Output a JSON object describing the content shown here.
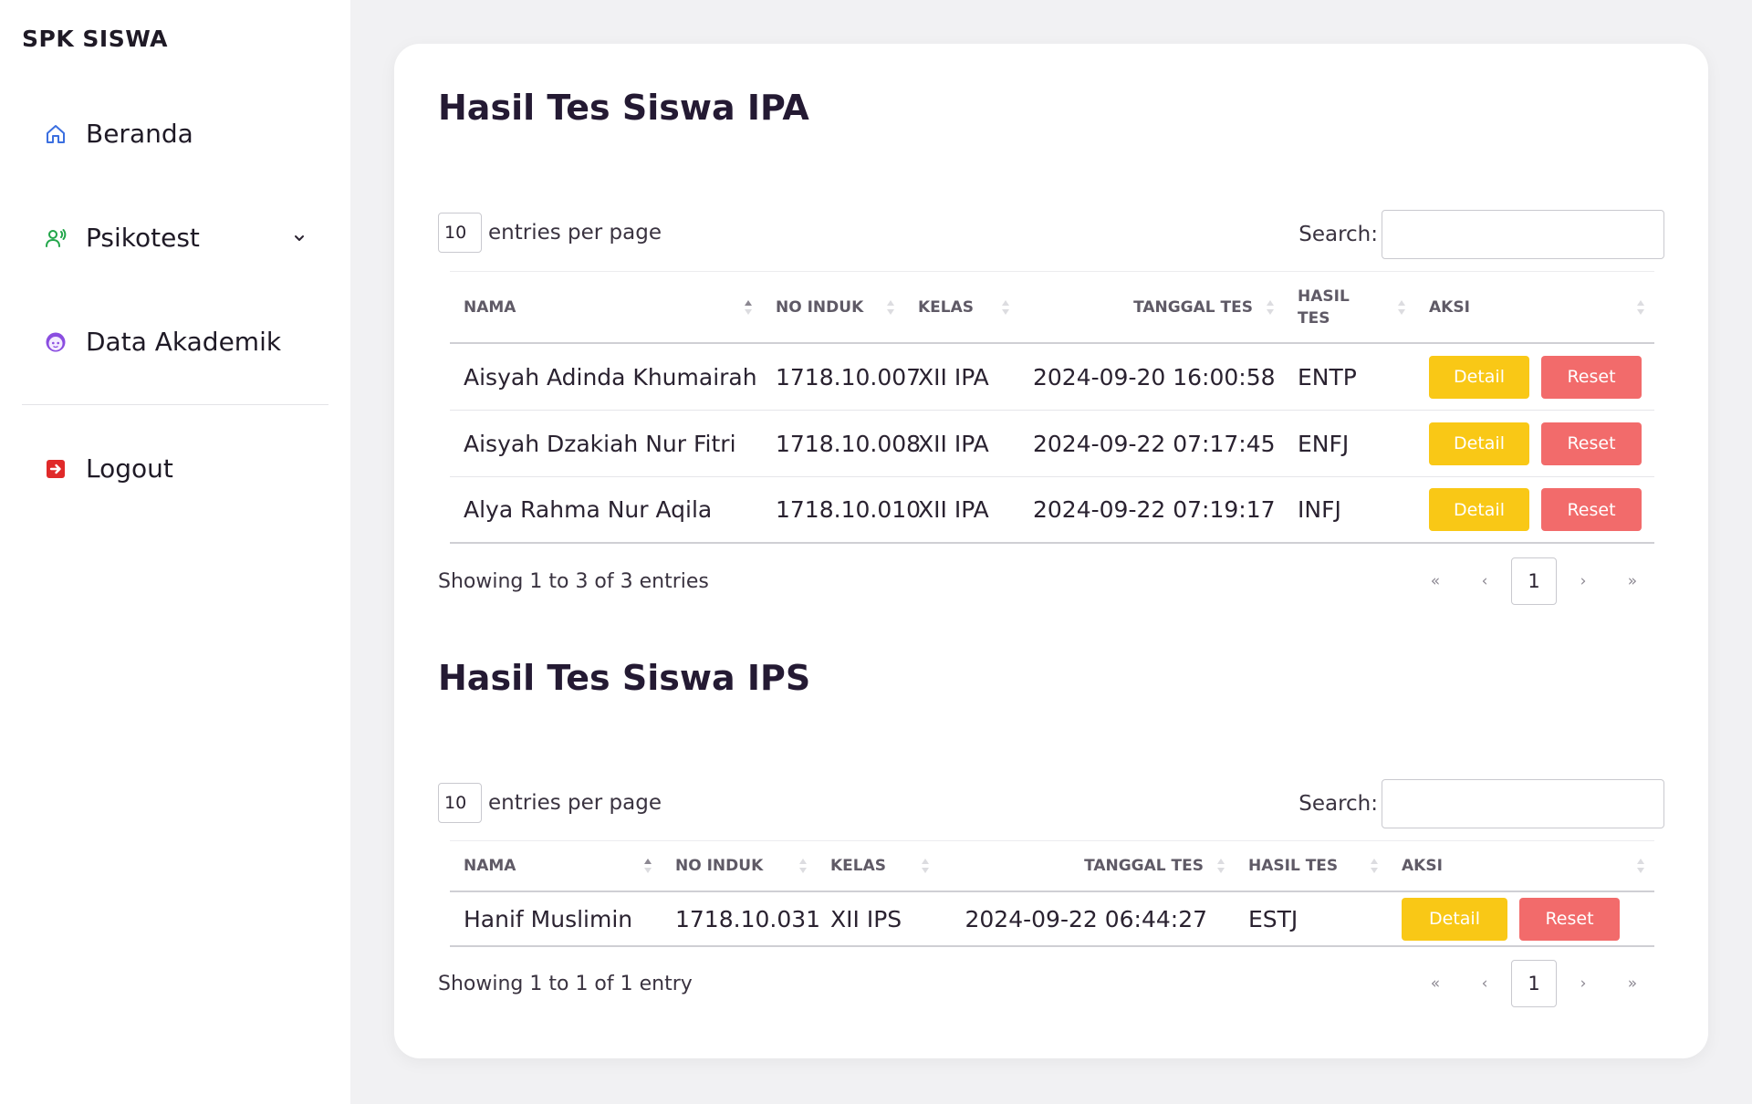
{
  "app": {
    "brand": "SPK SISWA"
  },
  "sidebar": {
    "items": [
      {
        "label": "Beranda",
        "icon": "home-icon",
        "color": "#3b6fe0"
      },
      {
        "label": "Psikotest",
        "icon": "user-voice-icon",
        "color": "#22a64a"
      },
      {
        "label": "Data Akademik",
        "icon": "face-icon",
        "color": "#8a4de0"
      },
      {
        "label": "Logout",
        "icon": "logout-icon",
        "color": "#e02a2a"
      }
    ]
  },
  "ipa": {
    "title": "Hasil Tes Siswa IPA",
    "length_value": "10",
    "length_text": "entries per page",
    "search_label": "Search:",
    "search_value": "",
    "columns": [
      "NAMA",
      "NO INDUK",
      "KELAS",
      "TANGGAL TES",
      "HASIL TES",
      "AKSI"
    ],
    "rows": [
      {
        "nama": "Aisyah Adinda Khumairah",
        "no_induk": "1718.10.007",
        "kelas": "XII IPA",
        "tanggal": "2024-09-20 16:00:58",
        "hasil": "ENTP",
        "detail": "Detail",
        "reset": "Reset"
      },
      {
        "nama": "Aisyah Dzakiah Nur Fitri",
        "no_induk": "1718.10.008",
        "kelas": "XII IPA",
        "tanggal": "2024-09-22 07:17:45",
        "hasil": "ENFJ",
        "detail": "Detail",
        "reset": "Reset"
      },
      {
        "nama": "Alya Rahma Nur Aqila",
        "no_induk": "1718.10.010",
        "kelas": "XII IPA",
        "tanggal": "2024-09-22 07:19:17",
        "hasil": "INFJ",
        "detail": "Detail",
        "reset": "Reset"
      }
    ],
    "info": "Showing 1 to 3 of 3 entries",
    "pagination": {
      "first": "«",
      "prev": "‹",
      "current": "1",
      "next": "›",
      "last": "»"
    }
  },
  "ips": {
    "title": "Hasil Tes Siswa IPS",
    "length_value": "10",
    "length_text": "entries per page",
    "search_label": "Search:",
    "search_value": "",
    "columns": [
      "NAMA",
      "NO INDUK",
      "KELAS",
      "TANGGAL TES",
      "HASIL TES",
      "AKSI"
    ],
    "rows": [
      {
        "nama": "Hanif Muslimin",
        "no_induk": "1718.10.031",
        "kelas": "XII IPS",
        "tanggal": "2024-09-22 06:44:27",
        "hasil": "ESTJ",
        "detail": "Detail",
        "reset": "Reset"
      }
    ],
    "info": "Showing 1 to 1 of 1 entry",
    "pagination": {
      "first": "«",
      "prev": "‹",
      "current": "1",
      "next": "›",
      "last": "»"
    }
  },
  "colors": {
    "detail": "#f9c816",
    "reset": "#f26b6b",
    "background": "#f1f1f3"
  }
}
